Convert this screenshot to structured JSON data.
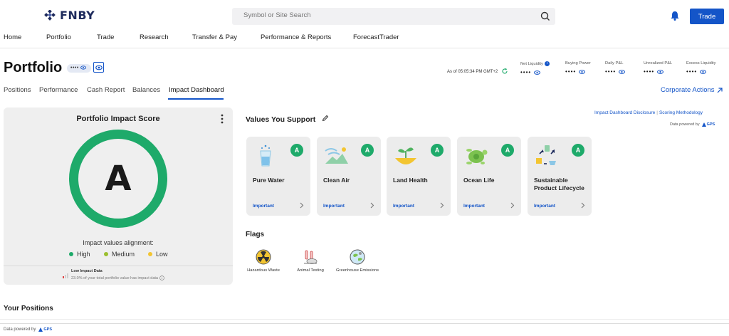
{
  "header": {
    "logo": "FNBY",
    "search_placeholder": "Symbol or Site Search",
    "trade_label": "Trade"
  },
  "nav": [
    "Home",
    "Portfolio",
    "Trade",
    "Research",
    "Transfer & Pay",
    "Performance & Reports",
    "ForecastTrader"
  ],
  "portfolio": {
    "title": "Portfolio",
    "masked_account": "••••",
    "as_of": "As of 05:05:34 PM GMT+2",
    "metrics": [
      {
        "label": "Net Liquidity",
        "value": "••••"
      },
      {
        "label": "Buying Power",
        "value": "••••"
      },
      {
        "label": "Daily P&L",
        "value": "••••"
      },
      {
        "label": "Unrealized P&L",
        "value": "••••"
      },
      {
        "label": "Excess Liquidity",
        "value": "••••"
      }
    ]
  },
  "tabs": [
    "Positions",
    "Performance",
    "Cash Report",
    "Balances",
    "Impact Dashboard"
  ],
  "corporate_actions": "Corporate Actions",
  "score": {
    "title": "Portfolio Impact Score",
    "grade": "A",
    "alignment_label": "Impact values alignment:",
    "legend": [
      {
        "label": "High",
        "color": "#1eaa6a"
      },
      {
        "label": "Medium",
        "color": "#9bbf2f"
      },
      {
        "label": "Low",
        "color": "#f3c531"
      }
    ],
    "low_data_title": "Low Impact Data",
    "low_data_sub": "23.0% of your total portfolio value has impact data"
  },
  "values": {
    "title": "Values You Support",
    "disclosure": "Impact Dashboard Disclosure",
    "methodology": "Scoring Methodology",
    "powered_by": "Data powered by",
    "provider": "GPS",
    "cards": [
      {
        "name": "Pure Water",
        "grade": "A",
        "level": "Important",
        "icon": "water-glass-icon"
      },
      {
        "name": "Clean Air",
        "grade": "A",
        "level": "Important",
        "icon": "clean-air-icon"
      },
      {
        "name": "Land Health",
        "grade": "A",
        "level": "Important",
        "icon": "sprout-icon"
      },
      {
        "name": "Ocean Life",
        "grade": "A",
        "level": "Important",
        "icon": "turtle-icon"
      },
      {
        "name": "Sustainable Product Lifecycle",
        "grade": "A",
        "level": "Important",
        "icon": "recycle-icon"
      }
    ]
  },
  "flags": {
    "title": "Flags",
    "items": [
      {
        "label": "Hazardous Waste",
        "icon": "radiation-icon"
      },
      {
        "label": "Animal Testing",
        "icon": "lab-rabbit-icon"
      },
      {
        "label": "Greenhouse Emissions",
        "icon": "globe-emissions-icon"
      }
    ]
  },
  "your_positions": "Your Positions",
  "footer": {
    "powered_by": "Data powered by",
    "provider": "GPS"
  }
}
